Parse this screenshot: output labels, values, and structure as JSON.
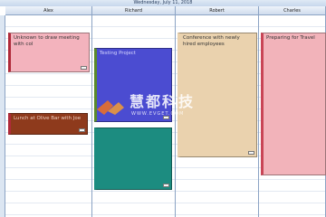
{
  "scheduler": {
    "date_range": "Wednesday, July 11, 2018",
    "resources": [
      "Alex",
      "Richard",
      "Robert",
      "Charles"
    ],
    "appointments": [
      {
        "resource": "Alex",
        "subject": "Unknown to draw meeting with col",
        "color": "#f3b3bd",
        "has_note": true
      },
      {
        "resource": "Alex",
        "subject": "Lunch at Olive Bar with Joe",
        "color": "#8e3a1c",
        "has_note": true
      },
      {
        "resource": "Richard",
        "subject": "Testing Project",
        "color": "#4b4cd1",
        "has_note": true
      },
      {
        "resource": "Richard",
        "subject": "",
        "color": "#1c8c80",
        "has_note": true
      },
      {
        "resource": "Robert",
        "subject": "Conference with newly hired employees",
        "color": "#ead2ae",
        "has_note": true
      },
      {
        "resource": "Charles",
        "subject": "Preparing for Travel",
        "color": "#f2b3ba",
        "has_note": false
      }
    ]
  },
  "watermark": {
    "text": "慧都科技",
    "subtext": "WWW.EVGET.COM"
  }
}
